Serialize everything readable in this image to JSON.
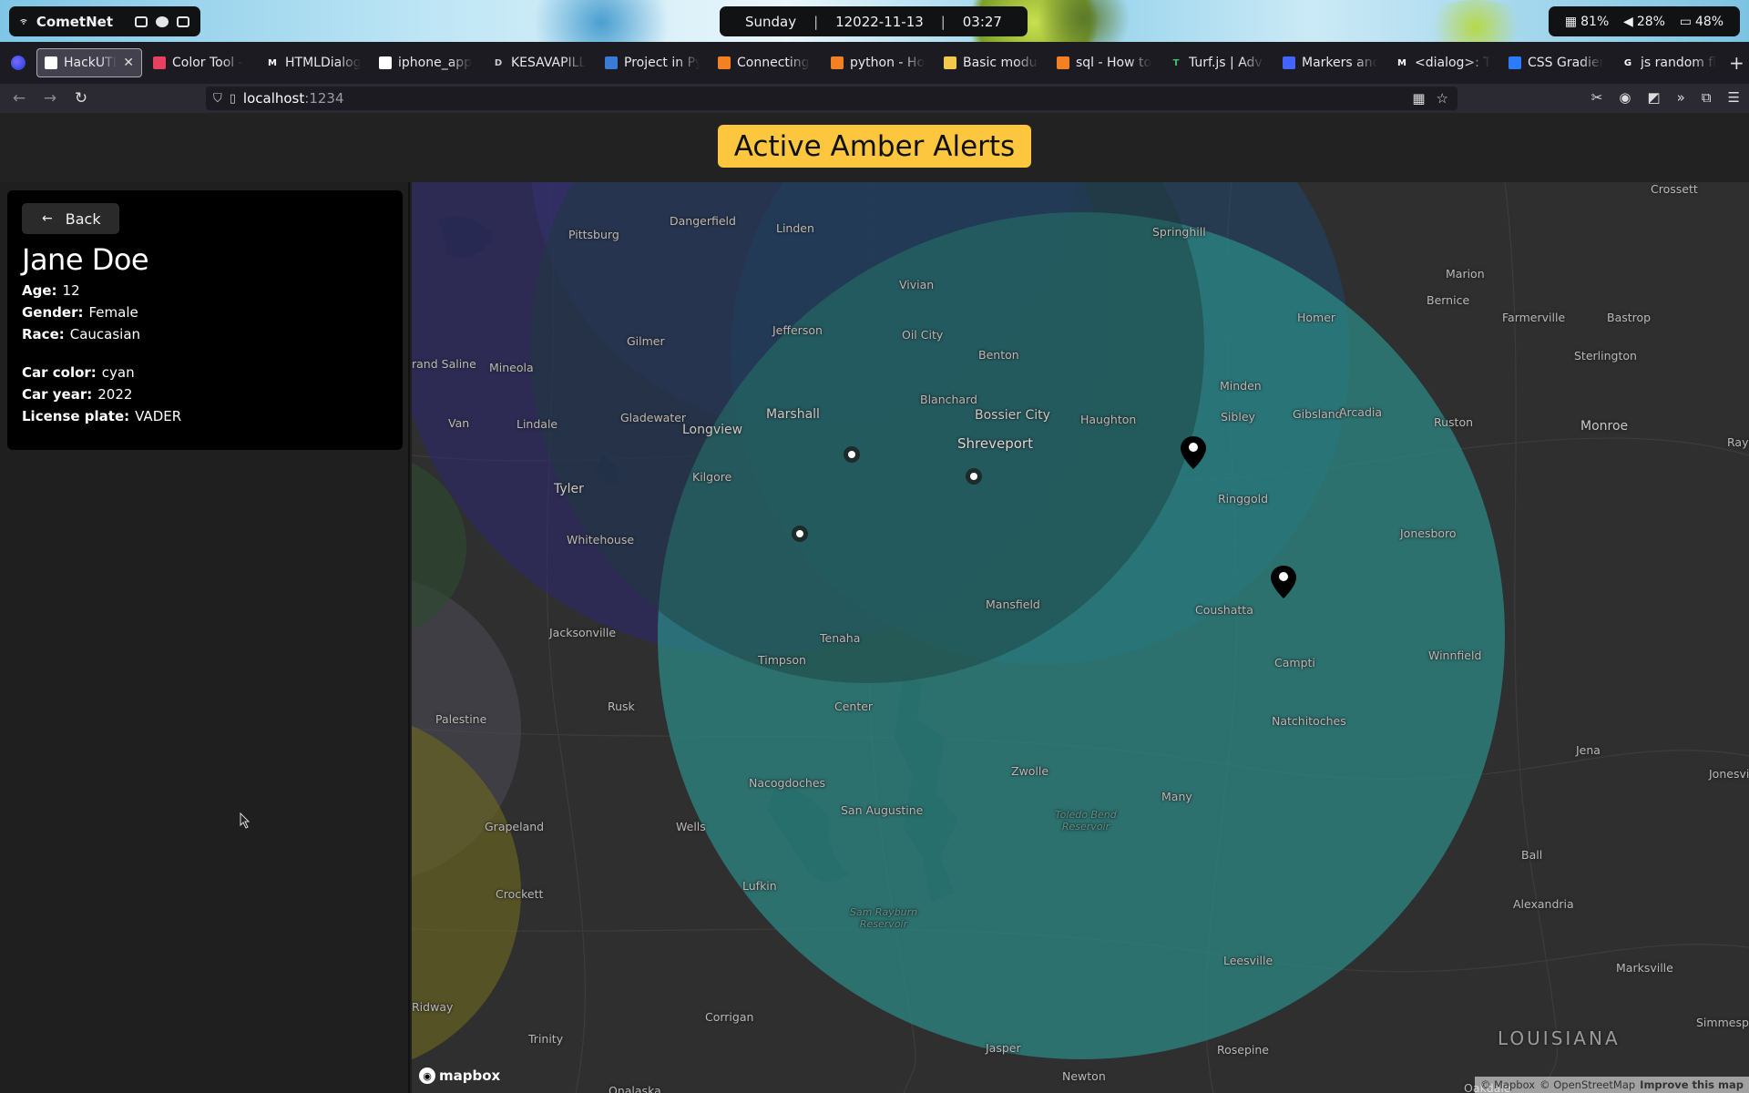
{
  "desktop": {
    "network_name": "CometNet",
    "day": "Sunday",
    "date": "12022-11-13",
    "time": "03:27",
    "stats": {
      "memory": "81%",
      "volume": "28%",
      "battery": "48%"
    }
  },
  "browser": {
    "tabs": [
      {
        "title": "HackUTD IX -",
        "fav_color": "#ffffff",
        "active": true
      },
      {
        "title": "Color Tool -",
        "fav_color": "#e84060"
      },
      {
        "title": "HTMLDialog",
        "fav_color": "#111111",
        "fav_glyph": "M"
      },
      {
        "title": "iphone_app",
        "fav_color": "#ffffff"
      },
      {
        "title": "KESAVAPILL",
        "fav_color": "#cccccc",
        "fav_glyph": "D"
      },
      {
        "title": "Project in Py",
        "fav_color": "#3b7bd8"
      },
      {
        "title": "Connecting",
        "fav_color": "#f48024"
      },
      {
        "title": "python - Ho",
        "fav_color": "#f48024"
      },
      {
        "title": "Basic modul",
        "fav_color": "#f2c94c"
      },
      {
        "title": "sql - How to",
        "fav_color": "#f48024"
      },
      {
        "title": "Turf.js | Adva",
        "fav_color": "#3ec46d",
        "fav_glyph": "T"
      },
      {
        "title": "Markers and",
        "fav_color": "#4264fb"
      },
      {
        "title": "<dialog>: Th",
        "fav_color": "#111111",
        "fav_glyph": "M"
      },
      {
        "title": "CSS Gradien",
        "fav_color": "#2b7bff"
      },
      {
        "title": "js random flo",
        "fav_color": "#ffffff",
        "fav_glyph": "G"
      }
    ],
    "url_host": "localhost",
    "url_port": ":1234"
  },
  "app": {
    "title": "Active Amber Alerts"
  },
  "sidebar": {
    "back_label": "Back",
    "name": "Jane Doe",
    "details": [
      {
        "key": "Age:",
        "value": "12"
      },
      {
        "key": "Gender:",
        "value": "Female"
      },
      {
        "key": "Race:",
        "value": "Caucasian"
      }
    ],
    "vehicle": [
      {
        "key": "Car color:",
        "value": "cyan"
      },
      {
        "key": "Car year:",
        "value": "2022"
      },
      {
        "key": "License plate:",
        "value": "VADER"
      }
    ]
  },
  "map": {
    "places": [
      "Crossett",
      "Springhill",
      "Marion",
      "Dangerfield",
      "Linden",
      "Pittsburg",
      "Vivian",
      "Homer",
      "Bernice",
      "Farmerville",
      "Bastrop",
      "Oil City",
      "Jefferson",
      "Sterlington",
      "Benton",
      "Minden",
      "Gilmer",
      "Mineola",
      "Blanchard",
      "Bossier City",
      "Haughton",
      "Sibley",
      "Gibsland",
      "Arcadia",
      "Ruston",
      "Monroe",
      "Gladewater",
      "Marshall",
      "Shreveport",
      "Longview",
      "Lindale",
      "Van",
      "Kilgore",
      "Ringgold",
      "Tyler",
      "Jonesboro",
      "Whitehouse",
      "Mansfield",
      "Coushatta",
      "Jacksonville",
      "Tenaha",
      "Timpson",
      "Campti",
      "Winnfield",
      "Rusk",
      "Center",
      "Natchitoches",
      "Palestine",
      "Jena",
      "Jonesville",
      "Zwolle",
      "Nacogdoches",
      "Many",
      "San Augustine",
      "Grapeland",
      "Wells",
      "Ball",
      "Toledo Bend Reservoir",
      "Crockett",
      "Lufkin",
      "Alexandria",
      "Sam Rayburn Reservoir",
      "Leesville",
      "Marksville",
      "Corrigan",
      "Jasper",
      "Rosepine",
      "Trinity",
      "Newton",
      "Oakdale",
      "Simmesport",
      "Ridway",
      "rand Saline",
      "Onalaska",
      "Rayv",
      "LOUISIANA"
    ],
    "alert_colors": {
      "teal": "#2b8b86",
      "indigo": "#2d2a6e",
      "blue": "#1d4a7a",
      "olive": "#6f6a1f",
      "gray": "#4a4a55",
      "green": "#2d4b2e"
    },
    "pins": {
      "sighting": 3,
      "marker": 2
    },
    "mapbox_label": "mapbox",
    "attribution": [
      "© Mapbox",
      "© OpenStreetMap",
      "Improve this map"
    ]
  }
}
